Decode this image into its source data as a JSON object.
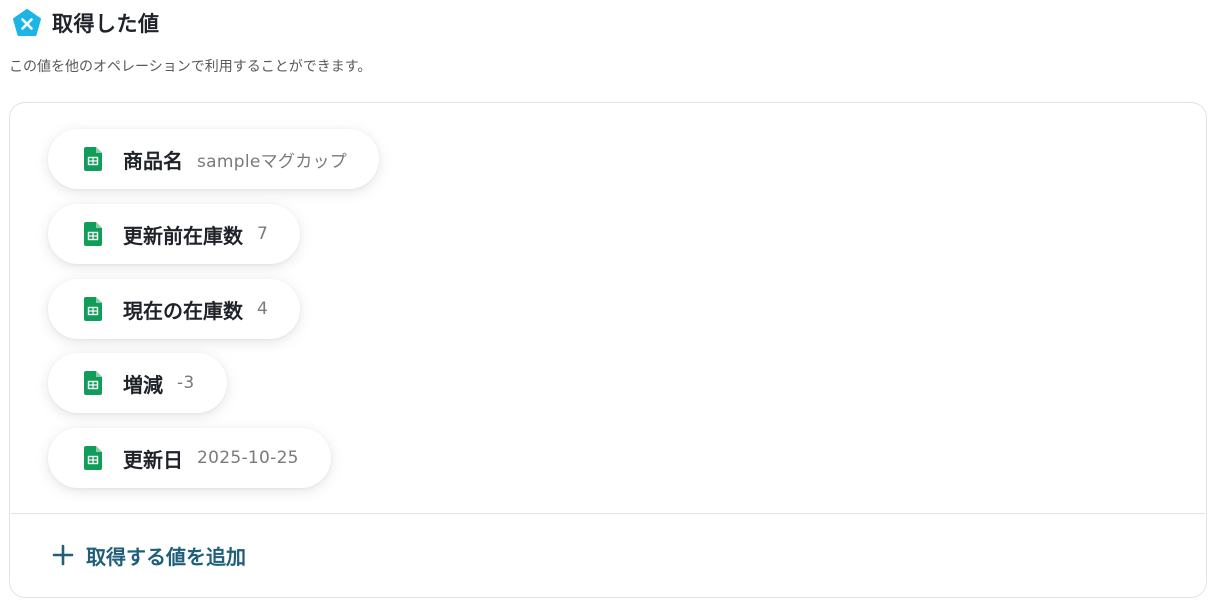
{
  "header": {
    "title": "取得した値",
    "icon": "yoom-x-pentagon-icon",
    "icon_color": "#1bb6e5"
  },
  "description": "この値を他のオペレーションで利用することができます。",
  "values": [
    {
      "label": "商品名",
      "value": "sampleマグカップ",
      "icon": "google-sheets-icon"
    },
    {
      "label": "更新前在庫数",
      "value": "7",
      "icon": "google-sheets-icon"
    },
    {
      "label": "現在の在庫数",
      "value": "4",
      "icon": "google-sheets-icon"
    },
    {
      "label": "増減",
      "value": "-3",
      "icon": "google-sheets-icon"
    },
    {
      "label": "更新日",
      "value": "2025-10-25",
      "icon": "google-sheets-icon"
    }
  ],
  "add_button": {
    "label": "取得する値を追加",
    "icon": "plus-icon",
    "color": "#1f5f7a"
  },
  "colors": {
    "sheets_green": "#0f9d58",
    "chip_value_gray": "#7a7a7a",
    "border": "#e1e3e6"
  }
}
